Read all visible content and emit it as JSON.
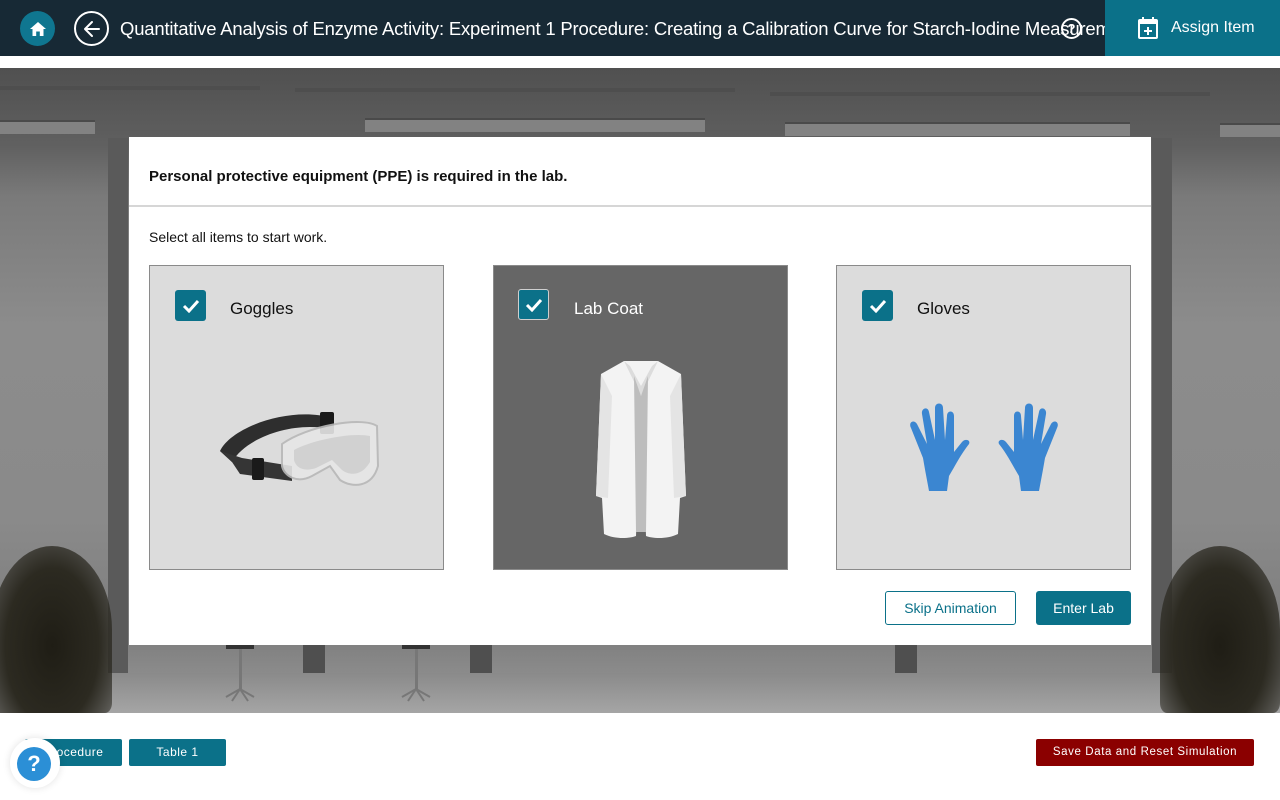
{
  "header": {
    "home_icon": "home-icon",
    "back_icon": "arrow-left-icon",
    "title": "Quantitative Analysis of Enzyme Activity: Experiment 1 Procedure: Creating a Calibration Curve for Starch-Iodine Measurem…",
    "help_icon": "question-circle-icon",
    "help_symbol": "?",
    "assign_icon": "calendar-plus-icon",
    "assign_label": "Assign Item"
  },
  "modal": {
    "heading": "Personal protective equipment (PPE) is required in the lab.",
    "instruction": "Select all items to start work.",
    "items": [
      {
        "label": "Goggles",
        "checked": true,
        "icon": "goggles-icon"
      },
      {
        "label": "Lab Coat",
        "checked": true,
        "icon": "lab-coat-icon",
        "highlighted": true
      },
      {
        "label": "Gloves",
        "checked": true,
        "icon": "gloves-icon"
      }
    ],
    "skip_label": "Skip Animation",
    "enter_label": "Enter Lab"
  },
  "footer": {
    "procedure_label": "Procedure",
    "table_label": "Table 1",
    "save_label": "Save Data and Reset Simulation",
    "help_symbol": "?"
  },
  "colors": {
    "header_bg": "#172935",
    "accent": "#0b7189",
    "danger": "#8b0000",
    "help_blue": "#2b8fd6"
  }
}
